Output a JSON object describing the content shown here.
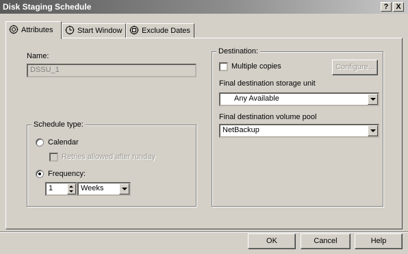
{
  "window": {
    "title": "Disk Staging Schedule",
    "help_btn": "?",
    "close_btn": "X"
  },
  "tabs": [
    {
      "label": "Attributes",
      "icon": "gear-clock-icon",
      "active": true
    },
    {
      "label": "Start Window",
      "icon": "clock-icon",
      "active": false
    },
    {
      "label": "Exclude Dates",
      "icon": "calendar-icon",
      "active": false
    }
  ],
  "name": {
    "label": "Name:",
    "value": "DSSU_1"
  },
  "schedule_type": {
    "title": "Schedule type:",
    "calendar_label": "Calendar",
    "retries_label": "Retries allowed after runday",
    "frequency_label": "Frequency:",
    "frequency_value": "1",
    "frequency_unit": "Weeks",
    "selected": "Frequency"
  },
  "destination": {
    "title": "Destination:",
    "multiple_copies_label": "Multiple copies",
    "configure_label": "Configure...",
    "storage_unit_label": "Final destination storage unit",
    "storage_unit_value": "Any Available",
    "volume_pool_label": "Final destination volume pool",
    "volume_pool_value": "NetBackup"
  },
  "footer": {
    "ok": "OK",
    "cancel": "Cancel",
    "help": "Help"
  }
}
